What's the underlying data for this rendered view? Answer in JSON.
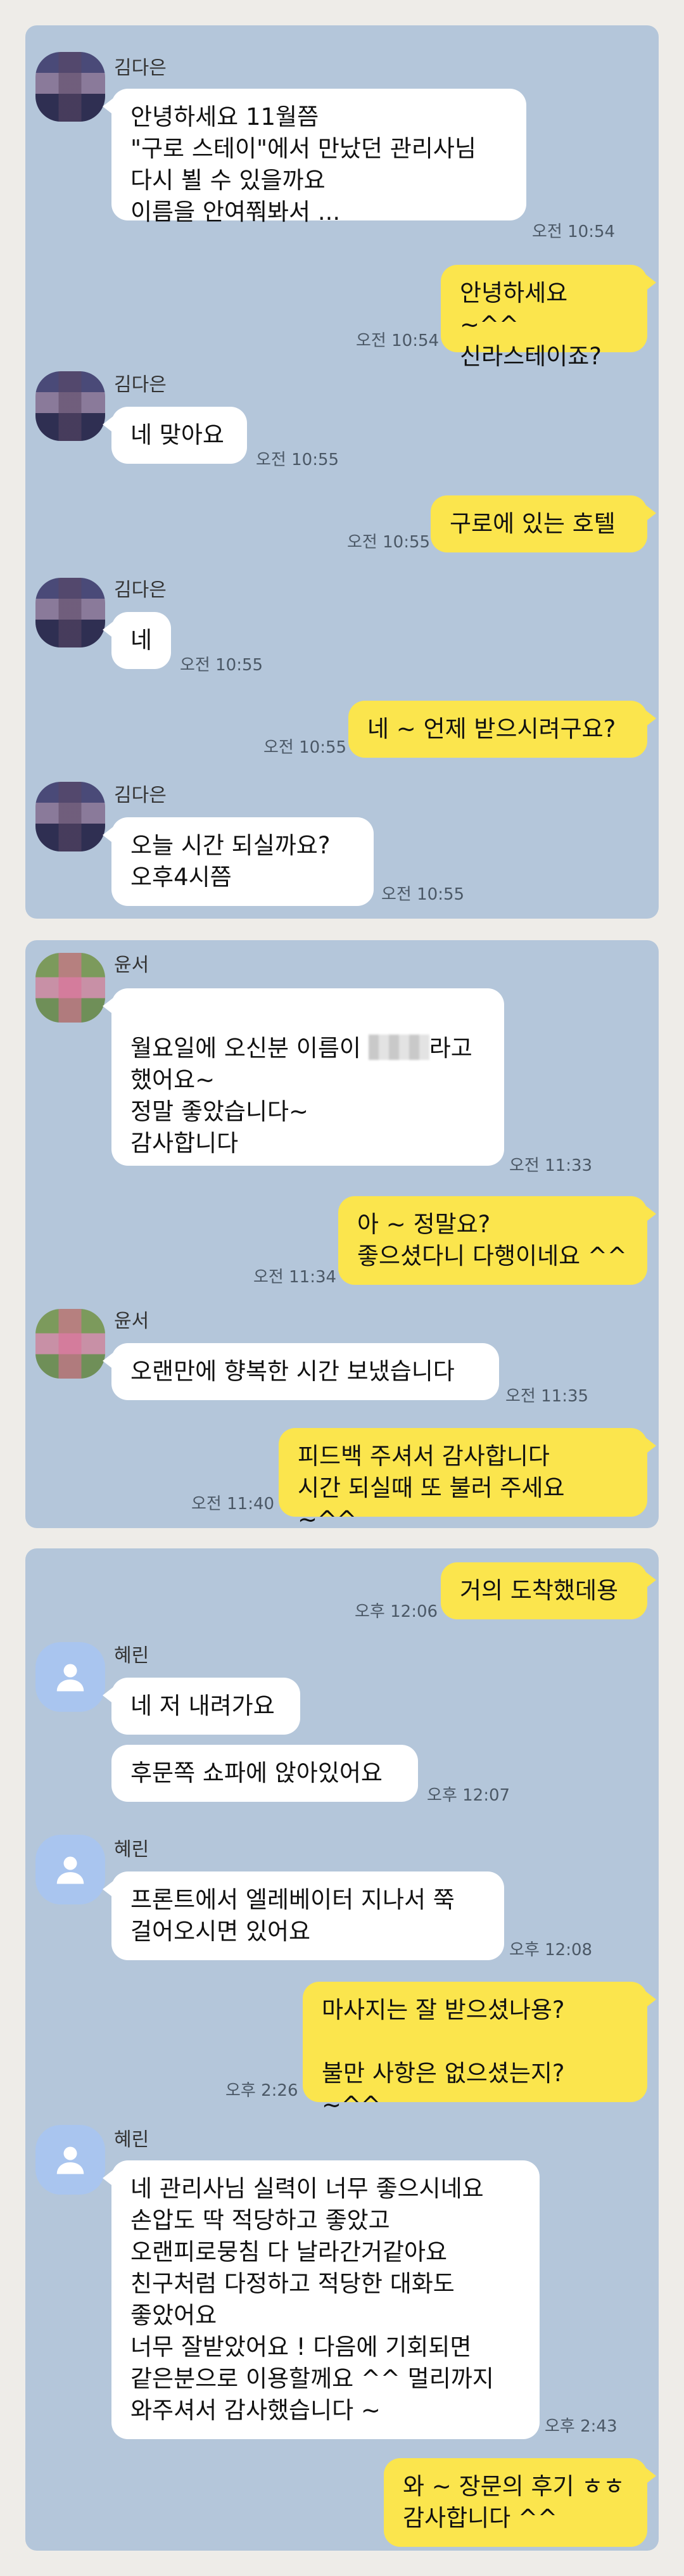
{
  "conversations": [
    {
      "messages": [
        {
          "side": "in",
          "sender": "김다은",
          "text": "안녕하세요 11월쯤\n\"구로 스테이\"에서 만났던 관리사님\n다시 뵐 수 있을까요\n이름을 안여쭤봐서 ...",
          "time": "오전 10:54"
        },
        {
          "side": "out",
          "text": "안녕하세요 ~^^\n신라스테이죠?",
          "time": "오전 10:54"
        },
        {
          "side": "in",
          "sender": "김다은",
          "text": "네 맞아요",
          "time": "오전 10:55"
        },
        {
          "side": "out",
          "text": "구로에 있는 호텔",
          "time": "오전 10:55"
        },
        {
          "side": "in",
          "sender": "김다은",
          "text": "네",
          "time": "오전 10:55"
        },
        {
          "side": "out",
          "text": "네 ~ 언제 받으시려구요?",
          "time": "오전 10:55"
        },
        {
          "side": "in",
          "sender": "김다은",
          "text": "오늘  시간 되실까요?\n오후4시쯤",
          "time": "오전 10:55"
        }
      ]
    },
    {
      "messages": [
        {
          "side": "in",
          "sender": "윤서",
          "text_before_blur": "월요일에 오신분 이름이 ",
          "text_after_blur": "라고\n했어요~\n정말 좋았습니다~\n감사합니다",
          "time": "오전 11:33"
        },
        {
          "side": "out",
          "text": "아 ~ 정말요?\n좋으셨다니 다행이네요 ^^",
          "time": "오전 11:34"
        },
        {
          "side": "in",
          "sender": "윤서",
          "text": "오랜만에 향복한 시간 보냈습니다",
          "time": "오전 11:35"
        },
        {
          "side": "out",
          "text": "피드백 주셔서 감사합니다\n시간 되실때 또 불러 주세요 ~^^",
          "time": "오전 11:40"
        }
      ]
    },
    {
      "messages": [
        {
          "side": "out",
          "text": "거의 도착했데용",
          "time": "오후 12:06"
        },
        {
          "side": "in",
          "sender": "혜린",
          "text": "네 저 내려가요"
        },
        {
          "side": "in",
          "text": "후문쪽 쇼파에 앉아있어요",
          "time": "오후 12:07"
        },
        {
          "side": "in",
          "sender": "혜린",
          "text": "프론트에서 엘레베이터 지나서 쭉\n걸어오시면 있어요",
          "time": "오후 12:08"
        },
        {
          "side": "out",
          "text": "마사지는 잘 받으셨나용?\n\n불만 사항은 없으셨는지? ~^^",
          "time": "오후 2:26"
        },
        {
          "side": "in",
          "sender": "혜린",
          "text": "네 관리사님 실력이 너무 좋으시네요\n손압도 딱 적당하고 좋았고\n오랜피로뭉침 다 날라간거같아요\n친구처럼 다정하고 적당한 대화도\n좋았어요\n너무 잘받았어요 ! 다음에 기회되면\n같은분으로 이용할께요 ^^ 멀리까지\n와주셔서 감사했습니다 ~",
          "time": "오후 2:43"
        },
        {
          "side": "out",
          "text": "와 ~ 장문의 후기 ㅎㅎ\n감사합니다 ^^"
        }
      ]
    }
  ],
  "colors": {
    "chat_background": "#b4c6da",
    "incoming_bubble": "#ffffff",
    "outgoing_bubble": "#fbe54d",
    "page_background": "#eeece8"
  }
}
